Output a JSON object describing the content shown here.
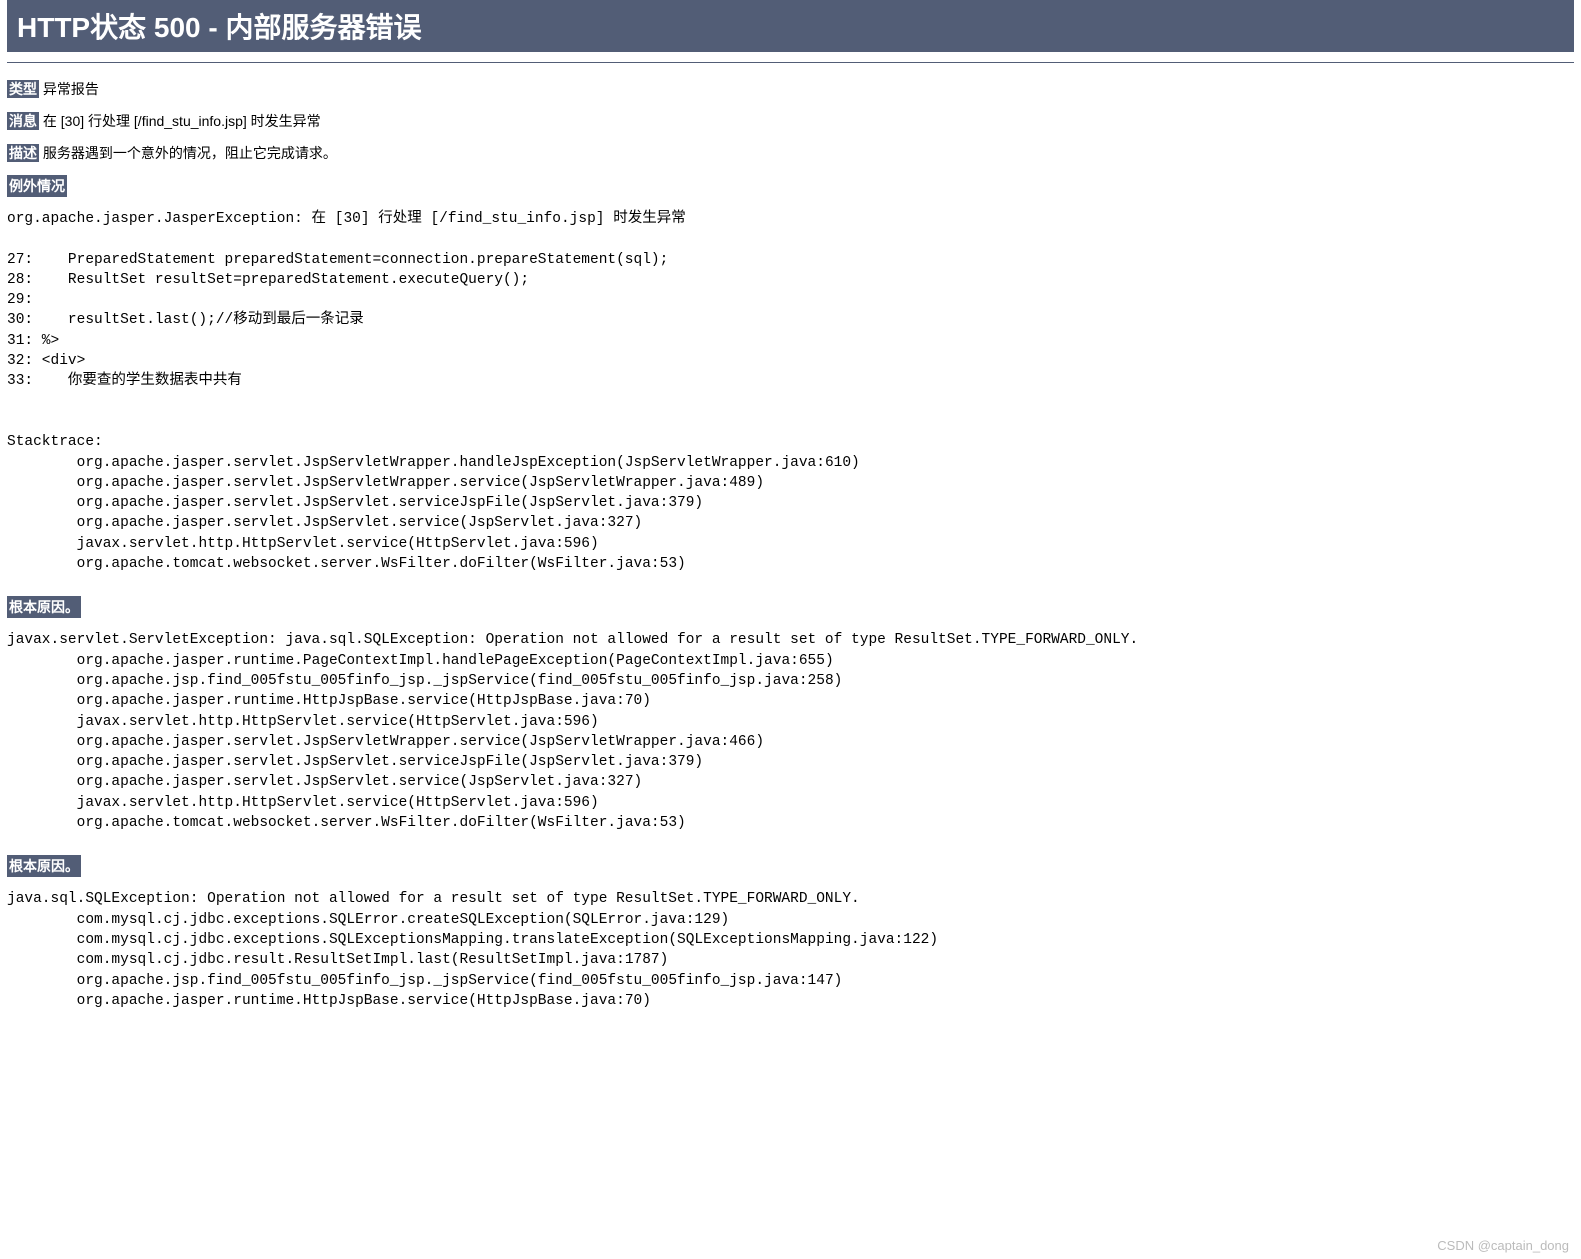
{
  "title": "HTTP状态 500 - 内部服务器错误",
  "type": {
    "label": "类型",
    "value": "异常报告"
  },
  "message": {
    "label": "消息",
    "value": "在 [30] 行处理 [/find_stu_info.jsp] 时发生异常"
  },
  "description": {
    "label": "描述",
    "value": "服务器遇到一个意外的情况，阻止它完成请求。"
  },
  "exception": {
    "label": "例外情况",
    "trace": "org.apache.jasper.JasperException: 在 [30] 行处理 [/find_stu_info.jsp] 时发生异常\n\n27:    PreparedStatement preparedStatement=connection.prepareStatement(sql);\n28:    ResultSet resultSet=preparedStatement.executeQuery();\n29:\n30:    resultSet.last();//移动到最后一条记录\n31: %>\n32: <div>\n33:    你要查的学生数据表中共有\n\n\nStacktrace:\n\torg.apache.jasper.servlet.JspServletWrapper.handleJspException(JspServletWrapper.java:610)\n\torg.apache.jasper.servlet.JspServletWrapper.service(JspServletWrapper.java:489)\n\torg.apache.jasper.servlet.JspServlet.serviceJspFile(JspServlet.java:379)\n\torg.apache.jasper.servlet.JspServlet.service(JspServlet.java:327)\n\tjavax.servlet.http.HttpServlet.service(HttpServlet.java:596)\n\torg.apache.tomcat.websocket.server.WsFilter.doFilter(WsFilter.java:53)"
  },
  "rootcause1": {
    "label": "根本原因。",
    "trace": "javax.servlet.ServletException: java.sql.SQLException: Operation not allowed for a result set of type ResultSet.TYPE_FORWARD_ONLY.\n\torg.apache.jasper.runtime.PageContextImpl.handlePageException(PageContextImpl.java:655)\n\torg.apache.jsp.find_005fstu_005finfo_jsp._jspService(find_005fstu_005finfo_jsp.java:258)\n\torg.apache.jasper.runtime.HttpJspBase.service(HttpJspBase.java:70)\n\tjavax.servlet.http.HttpServlet.service(HttpServlet.java:596)\n\torg.apache.jasper.servlet.JspServletWrapper.service(JspServletWrapper.java:466)\n\torg.apache.jasper.servlet.JspServlet.serviceJspFile(JspServlet.java:379)\n\torg.apache.jasper.servlet.JspServlet.service(JspServlet.java:327)\n\tjavax.servlet.http.HttpServlet.service(HttpServlet.java:596)\n\torg.apache.tomcat.websocket.server.WsFilter.doFilter(WsFilter.java:53)"
  },
  "rootcause2": {
    "label": "根本原因。",
    "trace": "java.sql.SQLException: Operation not allowed for a result set of type ResultSet.TYPE_FORWARD_ONLY.\n\tcom.mysql.cj.jdbc.exceptions.SQLError.createSQLException(SQLError.java:129)\n\tcom.mysql.cj.jdbc.exceptions.SQLExceptionsMapping.translateException(SQLExceptionsMapping.java:122)\n\tcom.mysql.cj.jdbc.result.ResultSetImpl.last(ResultSetImpl.java:1787)\n\torg.apache.jsp.find_005fstu_005finfo_jsp._jspService(find_005fstu_005finfo_jsp.java:147)\n\torg.apache.jasper.runtime.HttpJspBase.service(HttpJspBase.java:70)"
  },
  "watermark": "CSDN @captain_dong"
}
